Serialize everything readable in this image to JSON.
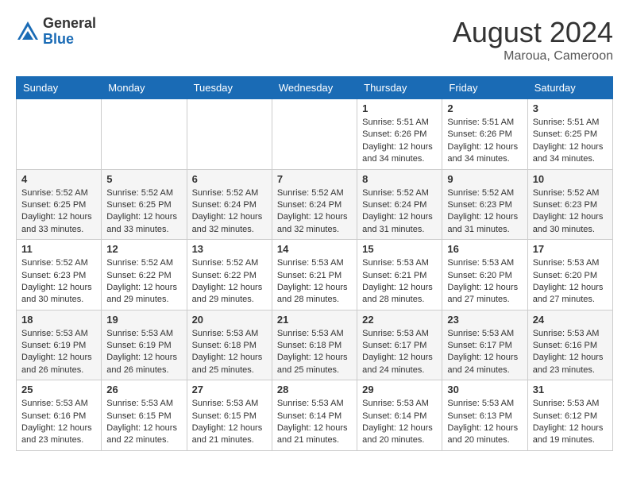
{
  "logo": {
    "general": "General",
    "blue": "Blue"
  },
  "title": {
    "month_year": "August 2024",
    "location": "Maroua, Cameroon"
  },
  "days_of_week": [
    "Sunday",
    "Monday",
    "Tuesday",
    "Wednesday",
    "Thursday",
    "Friday",
    "Saturday"
  ],
  "weeks": [
    [
      {
        "day": "",
        "info": ""
      },
      {
        "day": "",
        "info": ""
      },
      {
        "day": "",
        "info": ""
      },
      {
        "day": "",
        "info": ""
      },
      {
        "day": "1",
        "info": "Sunrise: 5:51 AM\nSunset: 6:26 PM\nDaylight: 12 hours\nand 34 minutes."
      },
      {
        "day": "2",
        "info": "Sunrise: 5:51 AM\nSunset: 6:26 PM\nDaylight: 12 hours\nand 34 minutes."
      },
      {
        "day": "3",
        "info": "Sunrise: 5:51 AM\nSunset: 6:25 PM\nDaylight: 12 hours\nand 34 minutes."
      }
    ],
    [
      {
        "day": "4",
        "info": "Sunrise: 5:52 AM\nSunset: 6:25 PM\nDaylight: 12 hours\nand 33 minutes."
      },
      {
        "day": "5",
        "info": "Sunrise: 5:52 AM\nSunset: 6:25 PM\nDaylight: 12 hours\nand 33 minutes."
      },
      {
        "day": "6",
        "info": "Sunrise: 5:52 AM\nSunset: 6:24 PM\nDaylight: 12 hours\nand 32 minutes."
      },
      {
        "day": "7",
        "info": "Sunrise: 5:52 AM\nSunset: 6:24 PM\nDaylight: 12 hours\nand 32 minutes."
      },
      {
        "day": "8",
        "info": "Sunrise: 5:52 AM\nSunset: 6:24 PM\nDaylight: 12 hours\nand 31 minutes."
      },
      {
        "day": "9",
        "info": "Sunrise: 5:52 AM\nSunset: 6:23 PM\nDaylight: 12 hours\nand 31 minutes."
      },
      {
        "day": "10",
        "info": "Sunrise: 5:52 AM\nSunset: 6:23 PM\nDaylight: 12 hours\nand 30 minutes."
      }
    ],
    [
      {
        "day": "11",
        "info": "Sunrise: 5:52 AM\nSunset: 6:23 PM\nDaylight: 12 hours\nand 30 minutes."
      },
      {
        "day": "12",
        "info": "Sunrise: 5:52 AM\nSunset: 6:22 PM\nDaylight: 12 hours\nand 29 minutes."
      },
      {
        "day": "13",
        "info": "Sunrise: 5:52 AM\nSunset: 6:22 PM\nDaylight: 12 hours\nand 29 minutes."
      },
      {
        "day": "14",
        "info": "Sunrise: 5:53 AM\nSunset: 6:21 PM\nDaylight: 12 hours\nand 28 minutes."
      },
      {
        "day": "15",
        "info": "Sunrise: 5:53 AM\nSunset: 6:21 PM\nDaylight: 12 hours\nand 28 minutes."
      },
      {
        "day": "16",
        "info": "Sunrise: 5:53 AM\nSunset: 6:20 PM\nDaylight: 12 hours\nand 27 minutes."
      },
      {
        "day": "17",
        "info": "Sunrise: 5:53 AM\nSunset: 6:20 PM\nDaylight: 12 hours\nand 27 minutes."
      }
    ],
    [
      {
        "day": "18",
        "info": "Sunrise: 5:53 AM\nSunset: 6:19 PM\nDaylight: 12 hours\nand 26 minutes."
      },
      {
        "day": "19",
        "info": "Sunrise: 5:53 AM\nSunset: 6:19 PM\nDaylight: 12 hours\nand 26 minutes."
      },
      {
        "day": "20",
        "info": "Sunrise: 5:53 AM\nSunset: 6:18 PM\nDaylight: 12 hours\nand 25 minutes."
      },
      {
        "day": "21",
        "info": "Sunrise: 5:53 AM\nSunset: 6:18 PM\nDaylight: 12 hours\nand 25 minutes."
      },
      {
        "day": "22",
        "info": "Sunrise: 5:53 AM\nSunset: 6:17 PM\nDaylight: 12 hours\nand 24 minutes."
      },
      {
        "day": "23",
        "info": "Sunrise: 5:53 AM\nSunset: 6:17 PM\nDaylight: 12 hours\nand 24 minutes."
      },
      {
        "day": "24",
        "info": "Sunrise: 5:53 AM\nSunset: 6:16 PM\nDaylight: 12 hours\nand 23 minutes."
      }
    ],
    [
      {
        "day": "25",
        "info": "Sunrise: 5:53 AM\nSunset: 6:16 PM\nDaylight: 12 hours\nand 23 minutes."
      },
      {
        "day": "26",
        "info": "Sunrise: 5:53 AM\nSunset: 6:15 PM\nDaylight: 12 hours\nand 22 minutes."
      },
      {
        "day": "27",
        "info": "Sunrise: 5:53 AM\nSunset: 6:15 PM\nDaylight: 12 hours\nand 21 minutes."
      },
      {
        "day": "28",
        "info": "Sunrise: 5:53 AM\nSunset: 6:14 PM\nDaylight: 12 hours\nand 21 minutes."
      },
      {
        "day": "29",
        "info": "Sunrise: 5:53 AM\nSunset: 6:14 PM\nDaylight: 12 hours\nand 20 minutes."
      },
      {
        "day": "30",
        "info": "Sunrise: 5:53 AM\nSunset: 6:13 PM\nDaylight: 12 hours\nand 20 minutes."
      },
      {
        "day": "31",
        "info": "Sunrise: 5:53 AM\nSunset: 6:12 PM\nDaylight: 12 hours\nand 19 minutes."
      }
    ]
  ]
}
